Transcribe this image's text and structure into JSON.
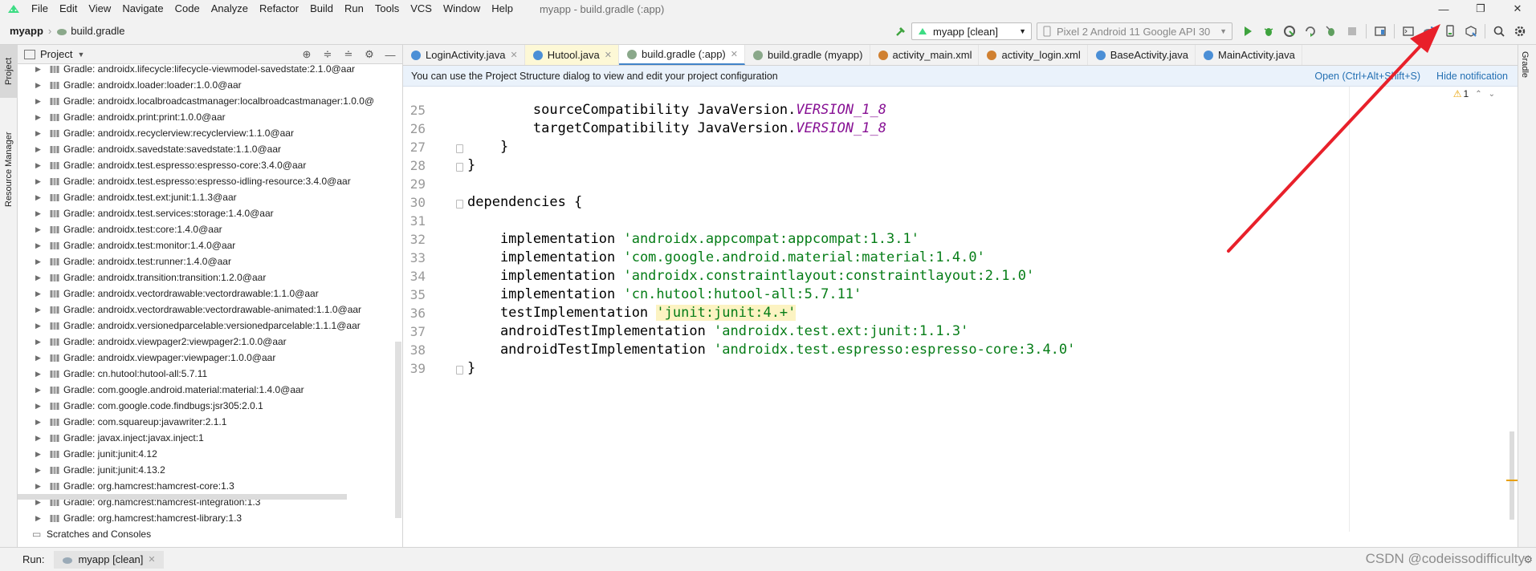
{
  "menubar": {
    "items": [
      "File",
      "Edit",
      "View",
      "Navigate",
      "Code",
      "Analyze",
      "Refactor",
      "Build",
      "Run",
      "Tools",
      "VCS",
      "Window",
      "Help"
    ],
    "window_title": "myapp - build.gradle (:app)"
  },
  "window_controls": {
    "minimize": "—",
    "restore": "❐",
    "close": "✕"
  },
  "navbar": {
    "project": "myapp",
    "file": "build.gradle",
    "run_config": "myapp [clean]",
    "device": "Pixel 2  Android 11 Google API 30"
  },
  "project_panel": {
    "title": "Project",
    "items": [
      "Gradle: androidx.lifecycle:lifecycle-viewmodel-savedstate:2.1.0@aar",
      "Gradle: androidx.loader:loader:1.0.0@aar",
      "Gradle: androidx.localbroadcastmanager:localbroadcastmanager:1.0.0@",
      "Gradle: androidx.print:print:1.0.0@aar",
      "Gradle: androidx.recyclerview:recyclerview:1.1.0@aar",
      "Gradle: androidx.savedstate:savedstate:1.1.0@aar",
      "Gradle: androidx.test.espresso:espresso-core:3.4.0@aar",
      "Gradle: androidx.test.espresso:espresso-idling-resource:3.4.0@aar",
      "Gradle: androidx.test.ext:junit:1.1.3@aar",
      "Gradle: androidx.test.services:storage:1.4.0@aar",
      "Gradle: androidx.test:core:1.4.0@aar",
      "Gradle: androidx.test:monitor:1.4.0@aar",
      "Gradle: androidx.test:runner:1.4.0@aar",
      "Gradle: androidx.transition:transition:1.2.0@aar",
      "Gradle: androidx.vectordrawable:vectordrawable:1.1.0@aar",
      "Gradle: androidx.vectordrawable:vectordrawable-animated:1.1.0@aar",
      "Gradle: androidx.versionedparcelable:versionedparcelable:1.1.1@aar",
      "Gradle: androidx.viewpager2:viewpager2:1.0.0@aar",
      "Gradle: androidx.viewpager:viewpager:1.0.0@aar",
      "Gradle: cn.hutool:hutool-all:5.7.11",
      "Gradle: com.google.android.material:material:1.4.0@aar",
      "Gradle: com.google.code.findbugs:jsr305:2.0.1",
      "Gradle: com.squareup:javawriter:2.1.1",
      "Gradle: javax.inject:javax.inject:1",
      "Gradle: junit:junit:4.12",
      "Gradle: junit:junit:4.13.2",
      "Gradle: org.hamcrest:hamcrest-core:1.3",
      "Gradle: org.hamcrest:hamcrest-integration:1.3",
      "Gradle: org.hamcrest:hamcrest-library:1.3"
    ],
    "footer_item": "Scratches and Consoles"
  },
  "side_tabs": {
    "project": "Project",
    "resource_manager": "Resource Manager",
    "gradle": "Gradle"
  },
  "editor_tabs": [
    {
      "label": "LoginActivity.java",
      "color": "#4b8fd6"
    },
    {
      "label": "Hutool.java",
      "color": "#4b8fd6"
    },
    {
      "label": "build.gradle (:app)",
      "color": "#8aa88a"
    },
    {
      "label": "build.gradle (myapp)",
      "color": "#8aa88a"
    },
    {
      "label": "activity_main.xml",
      "color": "#d08030"
    },
    {
      "label": "activity_login.xml",
      "color": "#d08030"
    },
    {
      "label": "BaseActivity.java",
      "color": "#4b8fd6"
    },
    {
      "label": "MainActivity.java",
      "color": "#4b8fd6"
    }
  ],
  "notification": {
    "text": "You can use the Project Structure dialog to view and edit your project configuration",
    "open_link": "Open (Ctrl+Alt+Shift+S)",
    "hide_link": "Hide notification"
  },
  "inspection": {
    "warnings": "1"
  },
  "code_lines": [
    {
      "n": "25",
      "prefix": "        sourceCompatibility JavaVersion.",
      "kw": "VERSION_1_8",
      "str": "",
      "rest": ""
    },
    {
      "n": "26",
      "prefix": "        targetCompatibility JavaVersion.",
      "kw": "VERSION_1_8",
      "str": "",
      "rest": ""
    },
    {
      "n": "27",
      "prefix": "    }",
      "kw": "",
      "str": "",
      "rest": ""
    },
    {
      "n": "28",
      "prefix": "}",
      "kw": "",
      "str": "",
      "rest": ""
    },
    {
      "n": "29",
      "prefix": "",
      "kw": "",
      "str": "",
      "rest": ""
    },
    {
      "n": "30",
      "prefix": "dependencies {",
      "kw": "",
      "str": "",
      "rest": ""
    },
    {
      "n": "31",
      "prefix": "",
      "kw": "",
      "str": "",
      "rest": ""
    },
    {
      "n": "32",
      "prefix": "    implementation ",
      "kw": "",
      "str": "'androidx.appcompat:appcompat:1.3.1'",
      "rest": ""
    },
    {
      "n": "33",
      "prefix": "    implementation ",
      "kw": "",
      "str": "'com.google.android.material:material:1.4.0'",
      "rest": ""
    },
    {
      "n": "34",
      "prefix": "    implementation ",
      "kw": "",
      "str": "'androidx.constraintlayout:constraintlayout:2.1.0'",
      "rest": ""
    },
    {
      "n": "35",
      "prefix": "    implementation ",
      "kw": "",
      "str": "'cn.hutool:hutool-all:5.7.11'",
      "rest": ""
    },
    {
      "n": "36",
      "prefix": "    testImplementation ",
      "kw": "",
      "str": "",
      "rest": "",
      "hl": "'junit:junit:4.+'"
    },
    {
      "n": "37",
      "prefix": "    androidTestImplementation ",
      "kw": "",
      "str": "'androidx.test.ext:junit:1.1.3'",
      "rest": ""
    },
    {
      "n": "38",
      "prefix": "    androidTestImplementation ",
      "kw": "",
      "str": "'androidx.test.espresso:espresso-core:3.4.0'",
      "rest": ""
    },
    {
      "n": "39",
      "prefix": "}",
      "kw": "",
      "str": "",
      "rest": ""
    }
  ],
  "runbar": {
    "label": "Run:",
    "tab": "myapp [clean]"
  },
  "watermark": "CSDN @codeissodifficulty",
  "colors": {
    "accent": "#4083c9",
    "string": "#067d17",
    "keyword": "#871094",
    "arrow": "#e8202a",
    "run_green": "#3ea33e"
  }
}
